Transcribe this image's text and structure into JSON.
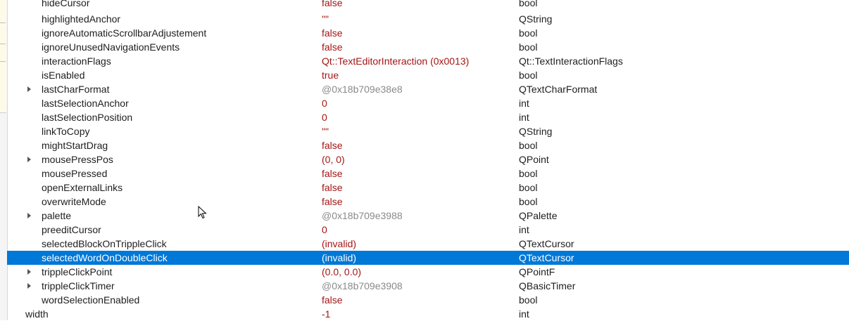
{
  "rows": [
    {
      "name": "hideCursor",
      "value": "false",
      "type": "bool",
      "expandable": false,
      "muted": false
    },
    {
      "name": "highlightedAnchor",
      "value": "\"\"",
      "type": "QString",
      "expandable": false,
      "muted": false
    },
    {
      "name": "ignoreAutomaticScrollbarAdjustement",
      "value": "false",
      "type": "bool",
      "expandable": false,
      "muted": false
    },
    {
      "name": "ignoreUnusedNavigationEvents",
      "value": "false",
      "type": "bool",
      "expandable": false,
      "muted": false
    },
    {
      "name": "interactionFlags",
      "value": "Qt::TextEditorInteraction (0x0013)",
      "type": "Qt::TextInteractionFlags",
      "expandable": false,
      "muted": false
    },
    {
      "name": "isEnabled",
      "value": "true",
      "type": "bool",
      "expandable": false,
      "muted": false
    },
    {
      "name": "lastCharFormat",
      "value": "@0x18b709e38e8",
      "type": "QTextCharFormat",
      "expandable": true,
      "muted": true
    },
    {
      "name": "lastSelectionAnchor",
      "value": "0",
      "type": "int",
      "expandable": false,
      "muted": false
    },
    {
      "name": "lastSelectionPosition",
      "value": "0",
      "type": "int",
      "expandable": false,
      "muted": false
    },
    {
      "name": "linkToCopy",
      "value": "\"\"",
      "type": "QString",
      "expandable": false,
      "muted": false
    },
    {
      "name": "mightStartDrag",
      "value": "false",
      "type": "bool",
      "expandable": false,
      "muted": false
    },
    {
      "name": "mousePressPos",
      "value": "(0, 0)",
      "type": "QPoint",
      "expandable": true,
      "muted": false
    },
    {
      "name": "mousePressed",
      "value": "false",
      "type": "bool",
      "expandable": false,
      "muted": false
    },
    {
      "name": "openExternalLinks",
      "value": "false",
      "type": "bool",
      "expandable": false,
      "muted": false
    },
    {
      "name": "overwriteMode",
      "value": "false",
      "type": "bool",
      "expandable": false,
      "muted": false
    },
    {
      "name": "palette",
      "value": "@0x18b709e3988",
      "type": "QPalette",
      "expandable": true,
      "muted": true
    },
    {
      "name": "preeditCursor",
      "value": "0",
      "type": "int",
      "expandable": false,
      "muted": false
    },
    {
      "name": "selectedBlockOnTrippleClick",
      "value": "(invalid)",
      "type": "QTextCursor",
      "expandable": false,
      "muted": false
    },
    {
      "name": "selectedWordOnDoubleClick",
      "value": "(invalid)",
      "type": "QTextCursor",
      "expandable": false,
      "muted": false,
      "selected": true
    },
    {
      "name": "trippleClickPoint",
      "value": "(0.0, 0.0)",
      "type": "QPointF",
      "expandable": true,
      "muted": false
    },
    {
      "name": "trippleClickTimer",
      "value": "@0x18b709e3908",
      "type": "QBasicTimer",
      "expandable": true,
      "muted": true
    },
    {
      "name": "wordSelectionEnabled",
      "value": "false",
      "type": "bool",
      "expandable": false,
      "muted": false
    },
    {
      "name": "width",
      "value": "-1",
      "type": "int",
      "expandable": false,
      "muted": false,
      "top_level": true
    }
  ],
  "colors": {
    "value": "#a31515",
    "muted_value": "#8a8a8a",
    "selection": "#0078d7"
  }
}
